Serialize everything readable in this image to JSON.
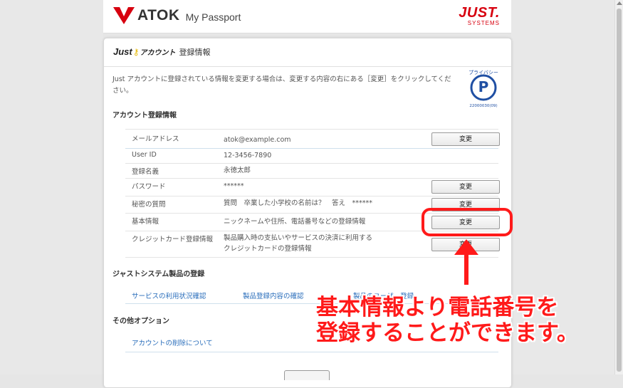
{
  "header": {
    "logo_text": "ATOK",
    "logo_sub": "My Passport",
    "brand_top": "JUST.",
    "brand_bottom": "SYSTEMS"
  },
  "card": {
    "title_just": "Just",
    "title_account": "アカウント",
    "title_label": "登録情報",
    "intro": "Just アカウントに登録されている情報を変更する場合は、変更する内容の右にある［変更］をクリックしてください。",
    "privacy_mark": {
      "text": "プライバシー",
      "number": "22000030(09)"
    }
  },
  "account_section": {
    "title": "アカウント登録情報",
    "rows": [
      {
        "label": "メールアドレス",
        "value": "atok@example.com",
        "button": "変更"
      },
      {
        "label": "User ID",
        "value": "12-3456-7890"
      },
      {
        "label": "登録名義",
        "value": "永徳太郎"
      },
      {
        "label": "パスワード",
        "value": "******",
        "button": "変更"
      },
      {
        "label": "秘密の質問",
        "value": "質問　卒業した小学校の名前は？　答え　******",
        "button": "変更"
      },
      {
        "label": "基本情報",
        "value": "ニックネームや住所、電話番号などの登録情報",
        "button": "変更"
      },
      {
        "label": "クレジットカード登録情報",
        "value_line1": "製品購入時の支払いやサービスの決済に利用する",
        "value_line2": "クレジットカードの登録情報",
        "button": "変更"
      }
    ]
  },
  "product_section": {
    "title": "ジャストシステム製品の登録",
    "links": [
      "サービスの利用状況確認",
      "製品登録内容の確認",
      "製品のユーザー登録"
    ]
  },
  "other_section": {
    "title": "その他オプション",
    "links": [
      "アカウントの削除について"
    ]
  },
  "annotation": {
    "line1": "基本情報より電話番号を",
    "line2": "登録することができます。",
    "color": "#ff1a1a"
  }
}
